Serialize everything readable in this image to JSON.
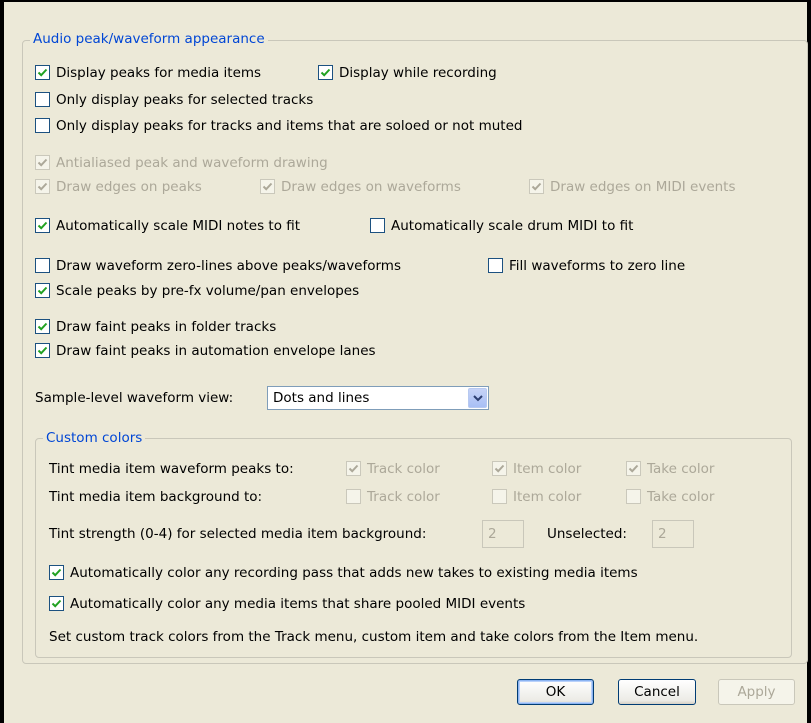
{
  "peaks": {
    "title": "Audio peak/waveform appearance",
    "display_peaks": {
      "label": "Display peaks for media items",
      "checked": true,
      "enabled": true
    },
    "display_while_recording": {
      "label": "Display while recording",
      "checked": true,
      "enabled": true
    },
    "only_selected": {
      "label": "Only display peaks for selected tracks",
      "checked": false,
      "enabled": true
    },
    "only_soloed": {
      "label": "Only display peaks for tracks and items that are soloed or not muted",
      "checked": false,
      "enabled": true
    },
    "antialiased": {
      "label": "Antialiased peak and waveform drawing",
      "checked": true,
      "enabled": false
    },
    "edges_peaks": {
      "label": "Draw edges on peaks",
      "checked": true,
      "enabled": false
    },
    "edges_waveforms": {
      "label": "Draw edges on waveforms",
      "checked": true,
      "enabled": false
    },
    "edges_midi": {
      "label": "Draw edges on MIDI events",
      "checked": true,
      "enabled": false
    },
    "scale_midi": {
      "label": "Automatically scale MIDI notes to fit",
      "checked": true,
      "enabled": true
    },
    "scale_drum": {
      "label": "Automatically scale drum MIDI to fit",
      "checked": false,
      "enabled": true
    },
    "zero_lines": {
      "label": "Draw waveform zero-lines above peaks/waveforms",
      "checked": false,
      "enabled": true
    },
    "fill_zero": {
      "label": "Fill waveforms to zero line",
      "checked": false,
      "enabled": true
    },
    "scale_prefx": {
      "label": "Scale peaks by pre-fx volume/pan envelopes",
      "checked": true,
      "enabled": true
    },
    "faint_folder": {
      "label": "Draw faint peaks in folder tracks",
      "checked": true,
      "enabled": true
    },
    "faint_auto": {
      "label": "Draw faint peaks in automation envelope lanes",
      "checked": true,
      "enabled": true
    },
    "sample_view_label": "Sample-level waveform view:",
    "sample_view_value": "Dots and lines"
  },
  "custom": {
    "title": "Custom colors",
    "tint_peaks_label": "Tint media item waveform peaks to:",
    "tint_bg_label": "Tint media item background to:",
    "peaks_track": {
      "label": "Track color",
      "checked": true,
      "enabled": false
    },
    "peaks_item": {
      "label": "Item color",
      "checked": true,
      "enabled": false
    },
    "peaks_take": {
      "label": "Take color",
      "checked": true,
      "enabled": false
    },
    "bg_track": {
      "label": "Track color",
      "checked": false,
      "enabled": false
    },
    "bg_item": {
      "label": "Item color",
      "checked": false,
      "enabled": false
    },
    "bg_take": {
      "label": "Take color",
      "checked": false,
      "enabled": false
    },
    "strength_label": "Tint strength (0-4) for selected media item background:",
    "strength_value": "2",
    "unselected_label": "Unselected:",
    "unselected_value": "2",
    "color_recording": {
      "label": "Automatically color any recording pass that adds new takes to existing media items",
      "checked": true,
      "enabled": true
    },
    "color_pooled": {
      "label": "Automatically color any media items that share pooled MIDI events",
      "checked": true,
      "enabled": true
    },
    "note": "Set custom track colors from the Track menu, custom item and take colors from the Item menu."
  },
  "buttons": {
    "ok": "OK",
    "cancel": "Cancel",
    "apply": "Apply"
  },
  "colors": {
    "accent": "#0046d5",
    "checkmark": "#21a121",
    "background": "#ece9d8"
  }
}
